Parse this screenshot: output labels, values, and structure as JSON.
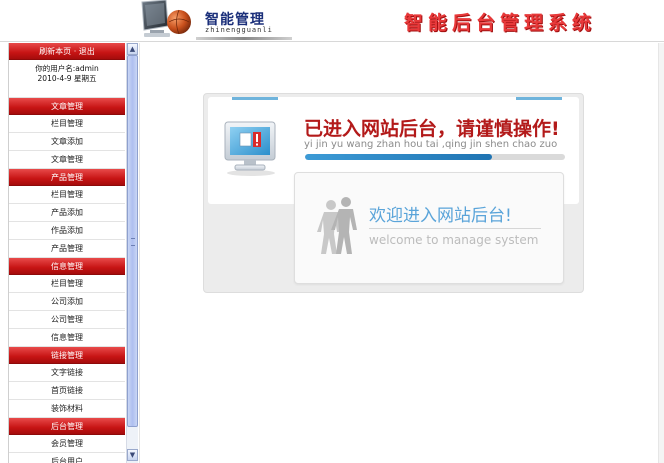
{
  "header": {
    "logo_title": "智能管理",
    "logo_pinyin": "zhinengguanli",
    "system_title": "智能后台管理系统"
  },
  "sidebar": {
    "top_links": "刷新本页 · 退出",
    "user_line": "你的用户名:admin",
    "date_line": "2010-4-9 星期五",
    "sections": [
      {
        "title": "文章管理",
        "items": [
          "栏目管理",
          "文章添加",
          "文章管理"
        ]
      },
      {
        "title": "产品管理",
        "items": [
          "栏目管理",
          "产品添加",
          "作品添加",
          "产品管理"
        ]
      },
      {
        "title": "信息管理",
        "items": [
          "栏目管理",
          "公司添加",
          "公司管理",
          "信息管理"
        ]
      },
      {
        "title": "链接管理",
        "items": [
          "文字链接",
          "首页链接",
          "装饰材料"
        ]
      },
      {
        "title": "后台管理",
        "items": [
          "会员管理",
          "后台用户"
        ]
      }
    ]
  },
  "main": {
    "notice": "已进入网站后台，请谨慎操作!",
    "notice_pinyin": "yi jin yu wang zhan hou tai ,qing jin shen chao zuo",
    "progress": 0.72,
    "welcome_title": "欢迎进入网站后台!",
    "welcome_subtitle": "welcome to manage system"
  },
  "icons": {
    "logo": "monitor-icon",
    "globe": "globe-icon",
    "pc": "computer-warning-icon",
    "people": "people-icon"
  },
  "colors": {
    "accent_red": "#c71414",
    "title_red": "#e8393a",
    "notice_red": "#b31a1a",
    "welcome_blue": "#5aa4d9"
  }
}
